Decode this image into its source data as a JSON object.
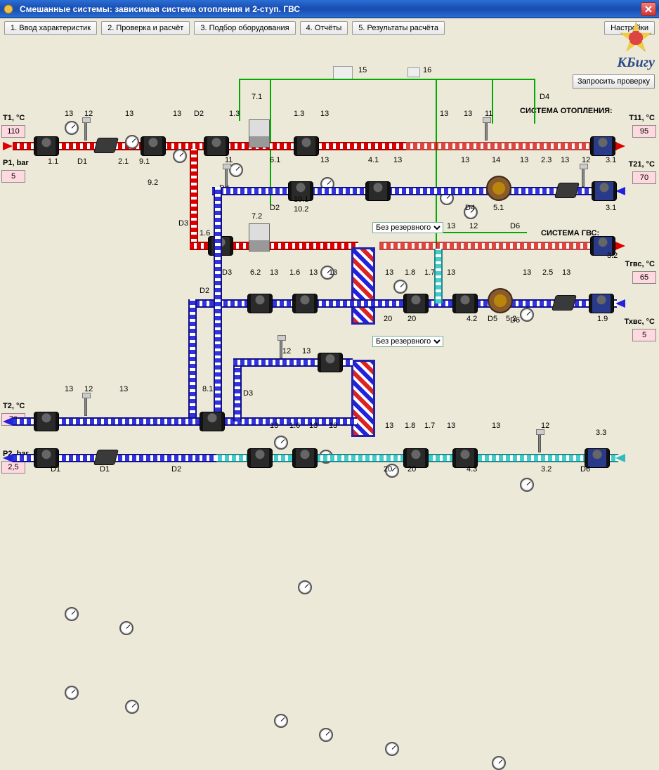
{
  "title": "Смешанные системы: зависимая система отопления и 2-ступ. ГВС",
  "tabs": {
    "t1": "1. Ввод характеристик",
    "t2": "2. Проверка и расчёт",
    "t3": "3. Подбор оборудования",
    "t4": "4. Отчёты",
    "t5": "5. Результаты расчёта",
    "settings": "Настройки"
  },
  "logo_text": "КБигу",
  "request_btn": "Запросить проверку",
  "sections": {
    "heating": "СИСТЕМА ОТОПЛЕНИЯ:",
    "dhw": "СИСТЕМА ГВС:"
  },
  "params": {
    "T1": {
      "label": "T1, °C",
      "value": "110"
    },
    "P1": {
      "label": "P1, bar",
      "value": "5"
    },
    "T2": {
      "label": "T2, °C",
      "value": "70"
    },
    "P2": {
      "label": "P2, bar",
      "value": "2,5"
    },
    "T11": {
      "label": "T11, °C",
      "value": "95"
    },
    "T21": {
      "label": "T21, °C",
      "value": "70"
    },
    "Tgvs": {
      "label": "Тгвс, °C",
      "value": "65"
    },
    "Thvs": {
      "label": "Тхвс, °C",
      "value": "5"
    }
  },
  "dropdown": {
    "reserve": "Без резервного"
  },
  "ids": {
    "d1": "D1",
    "d2": "D2",
    "d3": "D3",
    "d4": "D4",
    "d5": "D5",
    "d6": "D6",
    "n11": "11",
    "n12": "12",
    "n13": "13",
    "n14": "14",
    "n15": "15",
    "n16": "16",
    "n20": "20",
    "p1_1": "1.1",
    "p1_3": "1.3",
    "p1_6": "1.6",
    "p1_7": "1.7",
    "p1_8": "1.8",
    "p1_9": "1.9",
    "p2_1": "2.1",
    "p2_3": "2.3",
    "p2_5": "2.5",
    "p3_1": "3.1",
    "p3_2": "3.2",
    "p3_3": "3.3",
    "p4_1": "4.1",
    "p4_2": "4.2",
    "p4_3": "4.3",
    "p5_1": "5.1",
    "p5_2": "5.2",
    "p6_1": "6.1",
    "p6_2": "6.2",
    "p7_1": "7.1",
    "p7_2": "7.2",
    "p8_1": "8.1",
    "p9_1": "9.1",
    "p9_2": "9.2",
    "p10_1": "10.1",
    "p10_2": "10.2"
  }
}
